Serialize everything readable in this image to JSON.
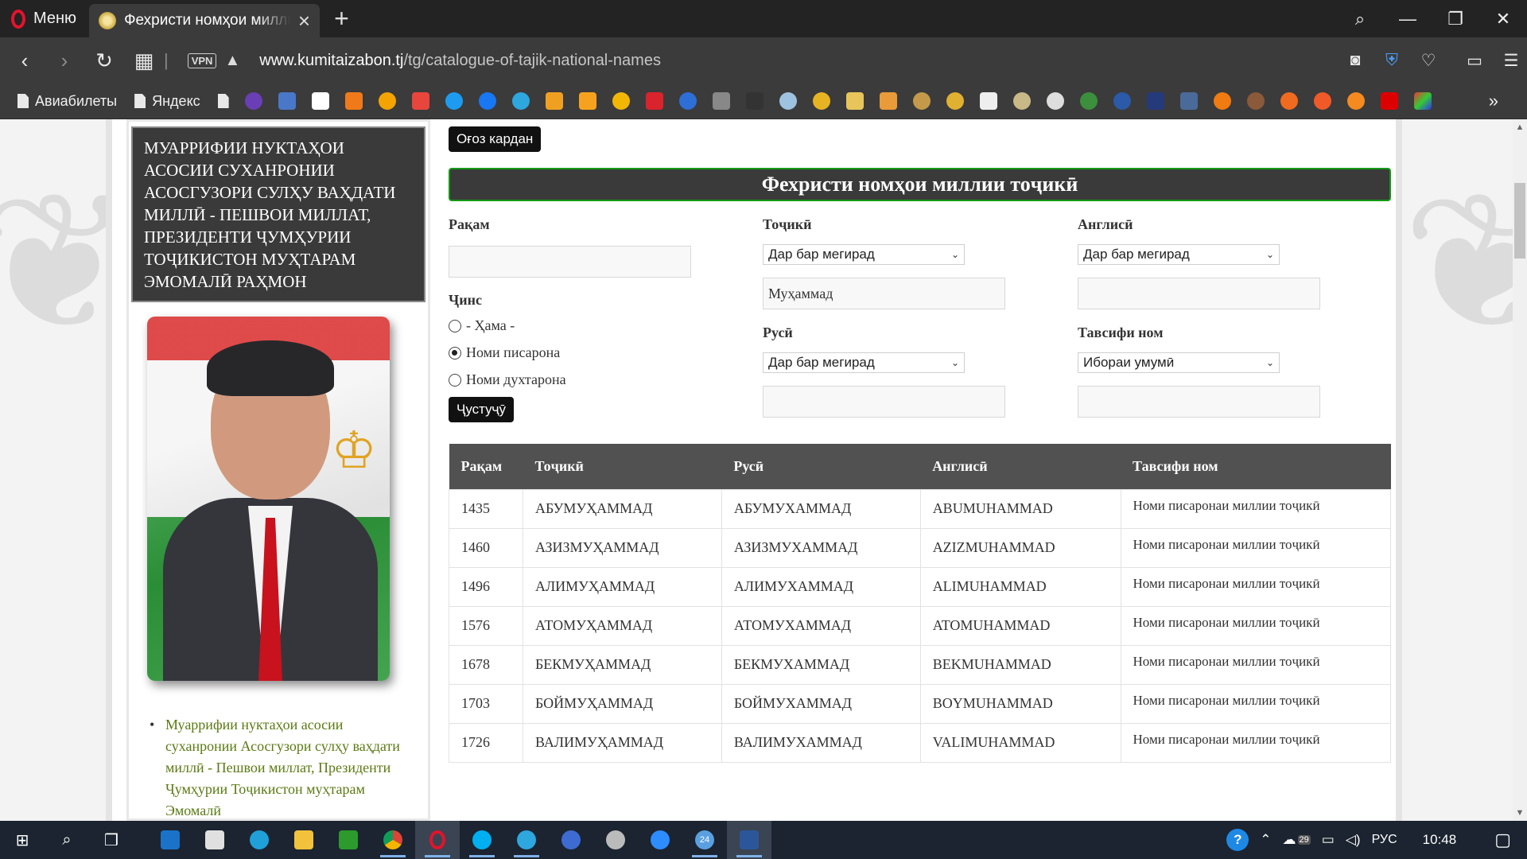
{
  "browser": {
    "menu_label": "Меню",
    "tab_title": "Фехристи номҳои миллии точикӣ",
    "vpn_label": "VPN",
    "url_host": "www.kumitaizabon.tj",
    "url_path": "/tg/catalogue-of-tajik-national-names",
    "bookmarks_text": [
      "Авиабилеты",
      "Яндекс"
    ]
  },
  "sidebar": {
    "title": "Муаррифии нуктаҳои асосии суханронии Асосгузори сулҳу ваҳдати миллӣ - Пешвои миллат, Президенти Ҷумҳурии Тоҷикистон муҳтарам Эмомалӣ Раҳмон",
    "link_text": "Муаррифии нуктаҳои асосии суханронии Асосгузори сулҳу ваҳдати миллӣ - Пешвои миллат, Президенти Ҷумҳурии Тоҷикистон муҳтарам Эмомалӣ"
  },
  "main": {
    "reset_button": "Оғоз кардан",
    "heading": "Фехристи номҳои миллии тоҷикӣ",
    "search_button": "Ҷустуҷӯ",
    "filters": {
      "number_label": "Рақам",
      "number_value": "",
      "gender_label": "Ҷинс",
      "gender_options": [
        "- Ҳама -",
        "Номи писарона",
        "Номи духтарона"
      ],
      "gender_selected": "Номи писарона",
      "tajik_label": "Тоҷикӣ",
      "tajik_mode": "Дар бар мегирад",
      "tajik_value": "Муҳаммад",
      "english_label": "Англисӣ",
      "english_mode": "Дар бар мегирад",
      "english_value": "",
      "russian_label": "Русӣ",
      "russian_mode": "Дар бар мегирад",
      "russian_value": "",
      "desc_label": "Тавсифи ном",
      "desc_mode": "Ибораи умумӣ",
      "desc_value": ""
    },
    "table": {
      "headers": [
        "Рақам",
        "Тоҷикӣ",
        "Русӣ",
        "Англисӣ",
        "Тавсифи ном"
      ],
      "rows": [
        {
          "num": "1435",
          "tj": "АБУМУҲАММАД",
          "ru": "АБУМУХАММАД",
          "en": "ABUMUHAMMAD",
          "desc": "Номи писаронаи миллии тоҷикӣ"
        },
        {
          "num": "1460",
          "tj": "АЗИЗМУҲАММАД",
          "ru": "АЗИЗМУХАММАД",
          "en": "AZIZMUHAMMAD",
          "desc": "Номи писаронаи миллии тоҷикӣ"
        },
        {
          "num": "1496",
          "tj": "АЛИМУҲАММАД",
          "ru": "АЛИМУХАММАД",
          "en": "ALIMUHAMMAD",
          "desc": "Номи писаронаи миллии тоҷикӣ"
        },
        {
          "num": "1576",
          "tj": "АТОМУҲАММАД",
          "ru": "АТОМУХАММАД",
          "en": "ATOMUHAMMAD",
          "desc": "Номи писаронаи миллии тоҷикӣ"
        },
        {
          "num": "1678",
          "tj": "БЕКМУҲАММАД",
          "ru": "БЕКМУХАММАД",
          "en": "BEKMUHAMMAD",
          "desc": "Номи писаронаи миллии тоҷикӣ"
        },
        {
          "num": "1703",
          "tj": "БОЙМУҲАММАД",
          "ru": "БОЙМУХАММАД",
          "en": "BOYMUHAMMAD",
          "desc": "Номи писаронаи миллии тоҷикӣ"
        },
        {
          "num": "1726",
          "tj": "ВАЛИМУҲАММАД",
          "ru": "ВАЛИМУХАММАД",
          "en": "VALIMUHAMMAD",
          "desc": "Номи писаронаи миллии тоҷикӣ"
        }
      ]
    }
  },
  "taskbar": {
    "weather": "29",
    "notification_count": "24",
    "language": "РУС",
    "time": "10:48"
  },
  "colors": {
    "heading_border": "#149a14",
    "link_green": "#5a7a12",
    "opera_red": "#e3132c",
    "table_header": "#515151"
  }
}
